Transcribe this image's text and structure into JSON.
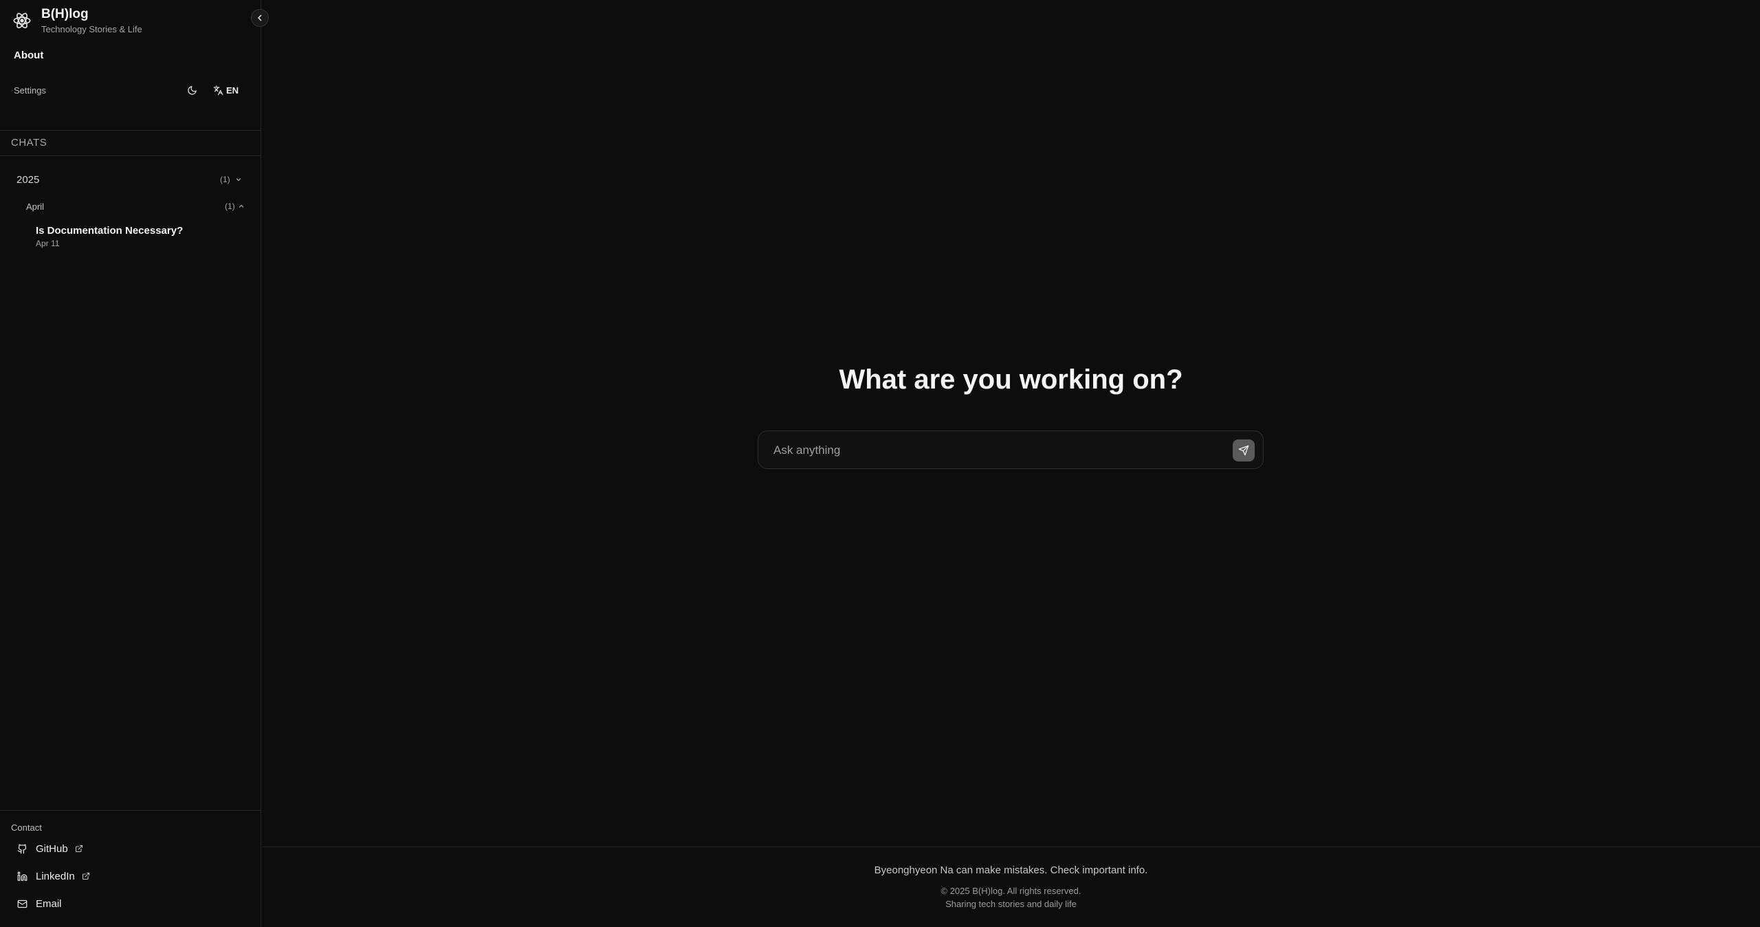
{
  "sidebar": {
    "brand": {
      "title": "B(H)log",
      "subtitle": "Technology Stories & Life",
      "logo_icon": "atom-logo-icon"
    },
    "collapse_icon": "chevron-left-icon",
    "nav": {
      "about_label": "About"
    },
    "settings": {
      "label": "Settings",
      "theme_icon": "moon-icon",
      "language_icon": "translate-icon",
      "language_label": "EN"
    },
    "chats": {
      "header": "CHATS",
      "years": [
        {
          "label": "2025",
          "count": "(1)",
          "months": [
            {
              "label": "April",
              "count": "(1)",
              "posts": [
                {
                  "title": "Is Documentation Necessary?",
                  "date": "Apr 11"
                }
              ]
            }
          ]
        }
      ]
    },
    "contact": {
      "label": "Contact",
      "links": [
        {
          "label": "GitHub",
          "icon": "github-icon",
          "external": true
        },
        {
          "label": "LinkedIn",
          "icon": "linkedin-icon",
          "external": true
        },
        {
          "label": "Email",
          "icon": "mail-icon",
          "external": false
        }
      ]
    }
  },
  "main": {
    "headline": "What are you working on?",
    "search": {
      "placeholder": "Ask anything",
      "value": "",
      "send_icon": "send-icon"
    },
    "footer": {
      "disclaimer": "Byeonghyeon Na can make mistakes. Check important info.",
      "copyright": "© 2025 B(H)log. All rights reserved.",
      "tagline": "Sharing tech stories and daily life"
    }
  },
  "colors": {
    "background": "#0d0d0d",
    "border": "#262626",
    "send_button": "#5a5a5a"
  }
}
